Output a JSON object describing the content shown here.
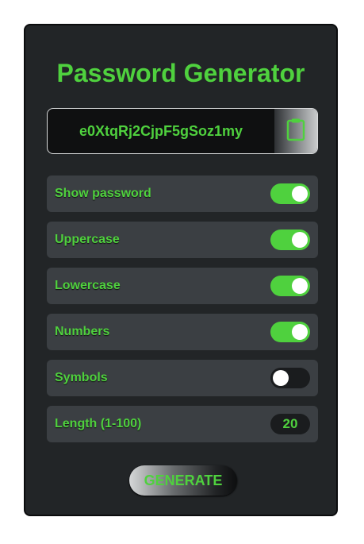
{
  "app": {
    "title": "Password Generator"
  },
  "password": {
    "value": "e0XtqRj2CjpF5gSoz1my",
    "copy_icon": "clipboard-icon"
  },
  "options": [
    {
      "label": "Show password",
      "enabled": true
    },
    {
      "label": "Uppercase",
      "enabled": true
    },
    {
      "label": "Lowercase",
      "enabled": true
    },
    {
      "label": "Numbers",
      "enabled": true
    },
    {
      "label": "Symbols",
      "enabled": false
    }
  ],
  "length": {
    "label": "Length (1-100)",
    "value": "20"
  },
  "generate_label": "GENERATE",
  "colors": {
    "accent": "#4fd13e",
    "card": "#222527",
    "row": "#3b3f43"
  }
}
